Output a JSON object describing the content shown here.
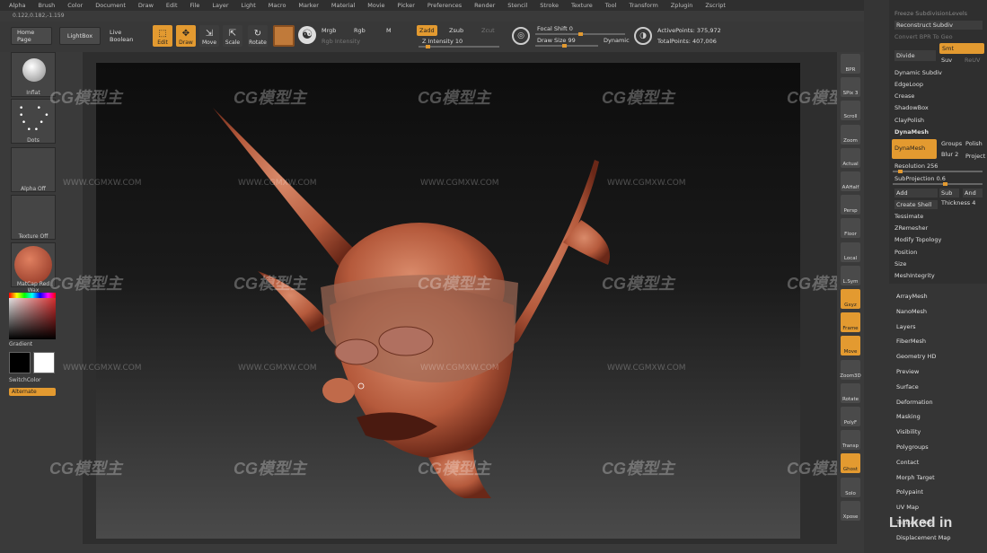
{
  "menu": [
    "Alpha",
    "Brush",
    "Color",
    "Document",
    "Draw",
    "Edit",
    "File",
    "Layer",
    "Light",
    "Macro",
    "Marker",
    "Material",
    "Movie",
    "Picker",
    "Preferences",
    "Render",
    "Stencil",
    "Stroke",
    "Texture",
    "Tool",
    "Transform",
    "Zplugin",
    "Zscript"
  ],
  "coords": "0.122,0.182,-1.159",
  "toolbar": {
    "home_page": "Home Page",
    "lightbox": "LightBox",
    "live_boolean": "Live Boolean",
    "edit": "Edit",
    "draw": "Draw",
    "move": "Move",
    "scale": "Scale",
    "rotate": "Rotate",
    "mrgb": "Mrgb",
    "rgb": "Rgb",
    "m": "M",
    "rgb_intensity": "Rgb Intensity",
    "zadd": "Zadd",
    "zsub": "Zsub",
    "zcut": "Zcut",
    "z_intensity": "Z Intensity 10",
    "z_intensity_value": 10,
    "focal_shift": "Focal Shift 0",
    "draw_size": "Draw Size 99",
    "dynamic": "Dynamic",
    "active_points": "ActivePoints: 375,972",
    "total_points": "TotalPoints: 407,006"
  },
  "left": {
    "items": [
      "Inflat",
      "Dots",
      "Alpha Off",
      "Texture Off",
      "MatCap Red Wax"
    ],
    "gradient": "Gradient",
    "switch_color": "SwitchColor",
    "alternate": "Alternate"
  },
  "watermark": {
    "logo": "CG模型主",
    "url": "WWW.CGMXW.COM"
  },
  "right_shelf": [
    "BPR",
    "SPix 3",
    "Scroll",
    "Zoom",
    "Actual",
    "AAHalf",
    "Persp",
    "Floor",
    "Local",
    "L.Sym",
    "Gxyz",
    "Frame",
    "Move",
    "Zoom3D",
    "Rotate",
    "PolyF",
    "Transp",
    "Ghost",
    "Solo",
    "Xpose"
  ],
  "geometry": {
    "header1": "Freeze SubdivisionLevels",
    "reconstruct": "Reconstruct Subdiv",
    "convert": "Convert BPR To Geo",
    "smt": "Smt",
    "divide": "Divide",
    "suv": "Suv",
    "relly": "ReUV",
    "items": [
      "Dynamic Subdiv",
      "EdgeLoop",
      "Crease",
      "ShadowBox",
      "ClayPolish",
      "DynaMesh"
    ],
    "dynamesh_btn": "DynaMesh",
    "groups": "Groups",
    "polish": "Polish",
    "blur": "Blur 2",
    "project": "Project",
    "resolution": "Resolution 256",
    "subprojection": "SubProjection 0.6",
    "add": "Add",
    "sub": "Sub",
    "and": "And",
    "create_shell": "Create Shell",
    "thickness": "Thickness 4",
    "items2": [
      "Tessimate",
      "ZRemesher",
      "Modify Topology",
      "Position",
      "Size",
      "MeshIntegrity"
    ]
  },
  "tool_menu": [
    "ArrayMesh",
    "NanoMesh",
    "Layers",
    "FiberMesh",
    "Geometry HD",
    "Preview",
    "Surface",
    "Deformation",
    "Masking",
    "Visibility",
    "Polygroups",
    "Contact",
    "Morph Target",
    "Polypaint",
    "UV Map",
    "Texture Map",
    "Displacement Map"
  ],
  "linkedin": "Linked in"
}
